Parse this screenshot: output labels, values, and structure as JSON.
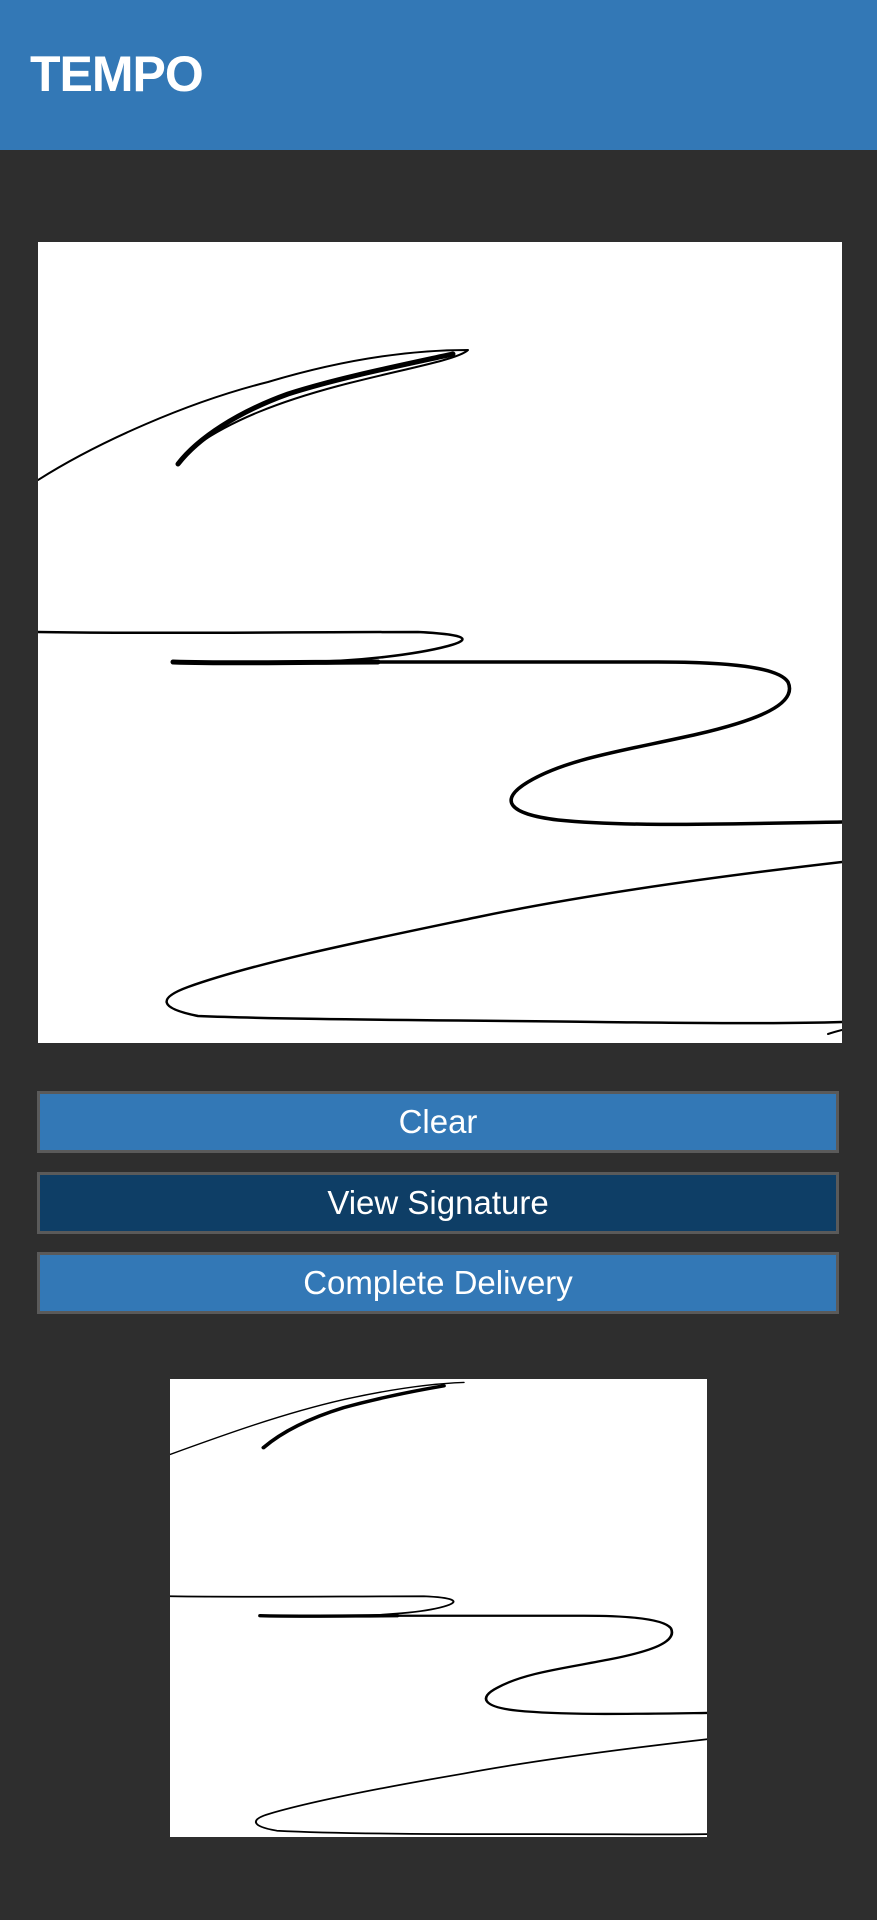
{
  "header": {
    "title": "TEMPO",
    "color": "#3378b6"
  },
  "signature_pad": {
    "label": "signature drawing area",
    "background": "#ffffff",
    "stroke_color": "#000000"
  },
  "buttons": {
    "clear": "Clear",
    "view_signature": "View Signature",
    "complete_delivery": "Complete Delivery"
  },
  "colors": {
    "background": "#2e2e2e",
    "button_primary": "#3378b6",
    "button_active": "#0e3e66",
    "button_text": "#ffffff"
  }
}
